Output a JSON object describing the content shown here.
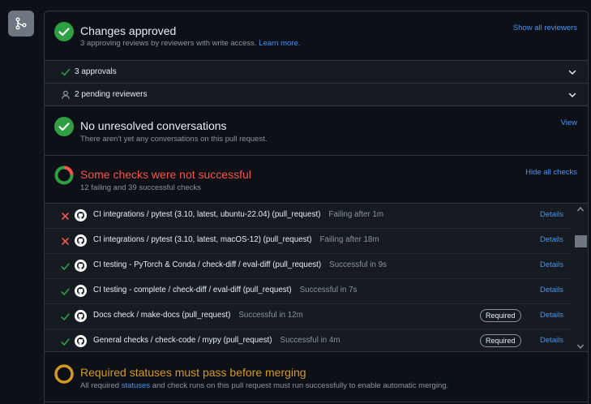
{
  "approval": {
    "title": "Changes approved",
    "subtitle": "3 approving reviews by reviewers with write access.",
    "learn_more": "Learn more.",
    "action": "Show all reviewers",
    "approvals_label": "3 approvals",
    "pending_label": "2 pending reviewers"
  },
  "conversations": {
    "title": "No unresolved conversations",
    "subtitle": "There aren't yet any conversations on this pull request.",
    "action": "View"
  },
  "checks": {
    "title": "Some checks were not successful",
    "subtitle": "12 failing and 39 successful checks",
    "action": "Hide all checks",
    "failing_count": 12,
    "successful_count": 39,
    "rows": [
      {
        "status": "fail",
        "name": "CI integrations / pytest (3.10, latest, ubuntu-22.04) (pull_request)",
        "duration": "Failing after 1m",
        "required": "",
        "details": "Details"
      },
      {
        "status": "fail",
        "name": "CI integrations / pytest (3.10, latest, macOS-12) (pull_request)",
        "duration": "Failing after 18m",
        "required": "",
        "details": "Details"
      },
      {
        "status": "pass",
        "name": "CI testing - PyTorch & Conda / check-diff / eval-diff (pull_request)",
        "duration": "Successful in 9s",
        "required": "",
        "details": "Details"
      },
      {
        "status": "pass",
        "name": "CI testing - complete / check-diff / eval-diff (pull_request)",
        "duration": "Successful in 7s",
        "required": "",
        "details": "Details"
      },
      {
        "status": "pass",
        "name": "Docs check / make-docs (pull_request)",
        "duration": "Successful in 12m",
        "required": "Required",
        "details": "Details"
      },
      {
        "status": "pass",
        "name": "General checks / check-code / mypy (pull_request)",
        "duration": "Successful in 4m",
        "required": "Required",
        "details": "Details"
      }
    ]
  },
  "required": {
    "title": "Required statuses must pass before merging",
    "subtitle_pre": "All required",
    "subtitle_link": "statuses",
    "subtitle_post": "and check runs on this pull request must run successfully to enable automatic merging."
  },
  "colors": {
    "success": "#2ea043",
    "danger": "#f85149",
    "attention": "#d29922",
    "accent": "#4493f8"
  }
}
